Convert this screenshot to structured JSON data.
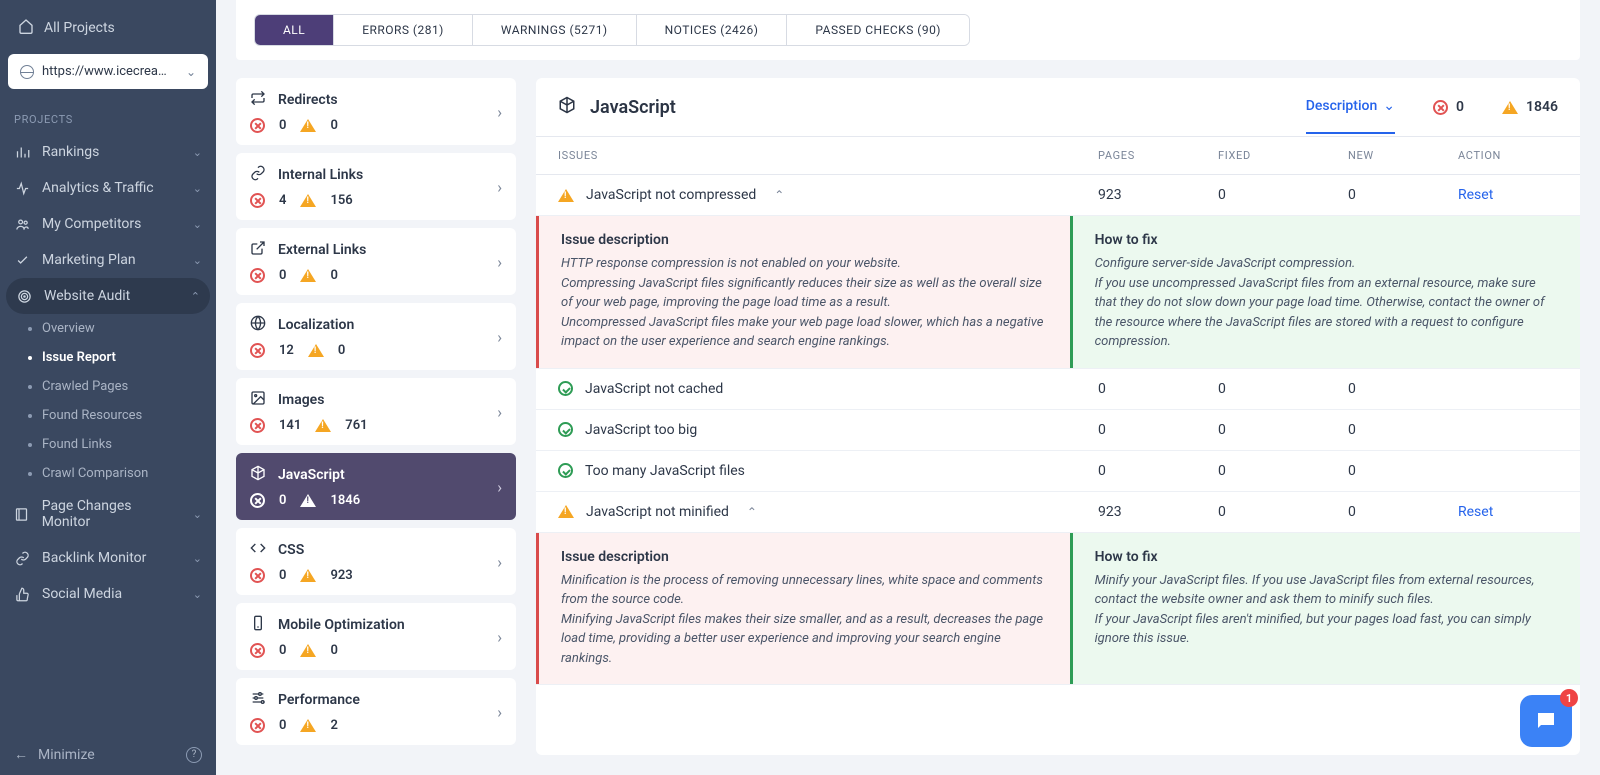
{
  "sidebar": {
    "all_projects": "All Projects",
    "project_url": "https://www.icecream…",
    "section_label": "PROJECTS",
    "items": [
      {
        "label": "Rankings",
        "icon": "bars"
      },
      {
        "label": "Analytics & Traffic",
        "icon": "pulse"
      },
      {
        "label": "My Competitors",
        "icon": "people"
      },
      {
        "label": "Marketing Plan",
        "icon": "check"
      },
      {
        "label": "Website Audit",
        "icon": "target",
        "expanded": true,
        "subs": [
          {
            "label": "Overview"
          },
          {
            "label": "Issue Report",
            "current": true
          },
          {
            "label": "Crawled Pages"
          },
          {
            "label": "Found Resources"
          },
          {
            "label": "Found Links"
          },
          {
            "label": "Crawl Comparison"
          }
        ]
      },
      {
        "label": "Page Changes Monitor",
        "icon": "book"
      },
      {
        "label": "Backlink Monitor",
        "icon": "linkback"
      },
      {
        "label": "Social Media",
        "icon": "thumb"
      }
    ],
    "minimize": "Minimize"
  },
  "tabs": [
    {
      "label": "ALL",
      "active": true
    },
    {
      "label": "ERRORS (281)"
    },
    {
      "label": "WARNINGS (5271)"
    },
    {
      "label": "NOTICES (2426)"
    },
    {
      "label": "PASSED CHECKS (90)"
    }
  ],
  "categories": [
    {
      "name": "Redirects",
      "icon": "redir",
      "err": 0,
      "warn": 0
    },
    {
      "name": "Internal Links",
      "icon": "link",
      "err": 4,
      "warn": 156
    },
    {
      "name": "External Links",
      "icon": "ext",
      "err": 0,
      "warn": 0
    },
    {
      "name": "Localization",
      "icon": "globe",
      "err": 12,
      "warn": 0
    },
    {
      "name": "Images",
      "icon": "img",
      "err": 141,
      "warn": 761
    },
    {
      "name": "JavaScript",
      "icon": "cube",
      "err": 0,
      "warn": 1846,
      "selected": true
    },
    {
      "name": "CSS",
      "icon": "code",
      "err": 0,
      "warn": 923
    },
    {
      "name": "Mobile Optimization",
      "icon": "mobile",
      "err": 0,
      "warn": 0
    },
    {
      "name": "Performance",
      "icon": "sliders",
      "err": 0,
      "warn": 2
    }
  ],
  "detail": {
    "title": "JavaScript",
    "dropdown": "Description",
    "sum_err": 0,
    "sum_warn": 1846,
    "headers": {
      "issues": "ISSUES",
      "pages": "PAGES",
      "fixed": "FIXED",
      "new_": "NEW",
      "action": "ACTION"
    },
    "desc_h": "Issue description",
    "fix_h": "How to fix",
    "reset": "Reset",
    "rows": [
      {
        "status": "warn",
        "name": "JavaScript not compressed",
        "pages": 923,
        "fixed": 0,
        "new_": 0,
        "action": "Reset",
        "expanded": true,
        "desc": "HTTP response compression is not enabled on your website.\nCompressing JavaScript files significantly reduces their size as well as the overall size of your web page, improving the page load time as a result.\nUncompressed JavaScript files make your web page load slower, which has a negative impact on the user experience and search engine rankings.",
        "fix": "Configure server-side JavaScript compression.\nIf you use uncompressed JavaScript files from an external resource, make sure that they do not slow down your page load time. Otherwise, contact the owner of the resource where the JavaScript files are stored with a request to configure compression."
      },
      {
        "status": "ok",
        "name": "JavaScript not cached",
        "pages": 0,
        "fixed": 0,
        "new_": 0
      },
      {
        "status": "ok",
        "name": "JavaScript too big",
        "pages": 0,
        "fixed": 0,
        "new_": 0
      },
      {
        "status": "ok",
        "name": "Too many JavaScript files",
        "pages": 0,
        "fixed": 0,
        "new_": 0
      },
      {
        "status": "warn",
        "name": "JavaScript not minified",
        "pages": 923,
        "fixed": 0,
        "new_": 0,
        "action": "Reset",
        "expanded": true,
        "desc": "Minification is the process of removing unnecessary lines, white space and comments from the source code.\nMinifying JavaScript files makes their size smaller, and as a result, decreases the page load time, providing a better user experience and improving your search engine rankings.",
        "fix": "Minify your JavaScript files. If you use JavaScript files from external resources, contact the website owner and ask them to minify such files.\nIf your JavaScript files aren't minified, but your pages load fast, you can simply ignore this issue."
      }
    ]
  },
  "chat_badge": "1"
}
